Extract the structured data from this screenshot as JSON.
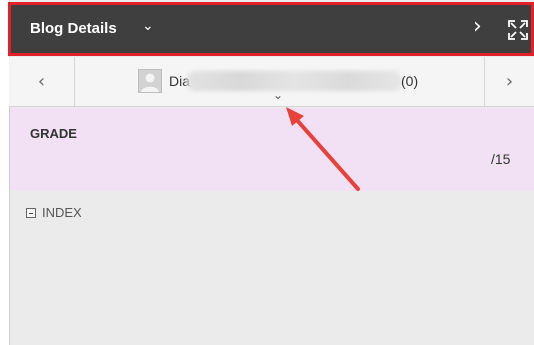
{
  "header": {
    "title": "Blog Details",
    "title_chevron_icon": "chevron-down-icon",
    "next_icon": "chevron-right-icon",
    "expand_icon": "expand-icon"
  },
  "navigator": {
    "prev_icon": "chevron-left-icon",
    "next_icon": "chevron-right-icon",
    "user_name": "Dia",
    "user_count": "(0)",
    "dropdown_icon": "chevron-down-icon"
  },
  "grade": {
    "label": "GRADE",
    "value": "/15"
  },
  "index": {
    "label": "INDEX",
    "toggle_icon": "collapse-box-icon"
  },
  "annotation": {
    "type": "arrow",
    "color": "#e8413a"
  },
  "colors": {
    "header_bg": "#3f3f3f",
    "header_border": "#e3212b",
    "grade_bg": "#f2e1f4",
    "panel_bg": "#ebebeb"
  }
}
